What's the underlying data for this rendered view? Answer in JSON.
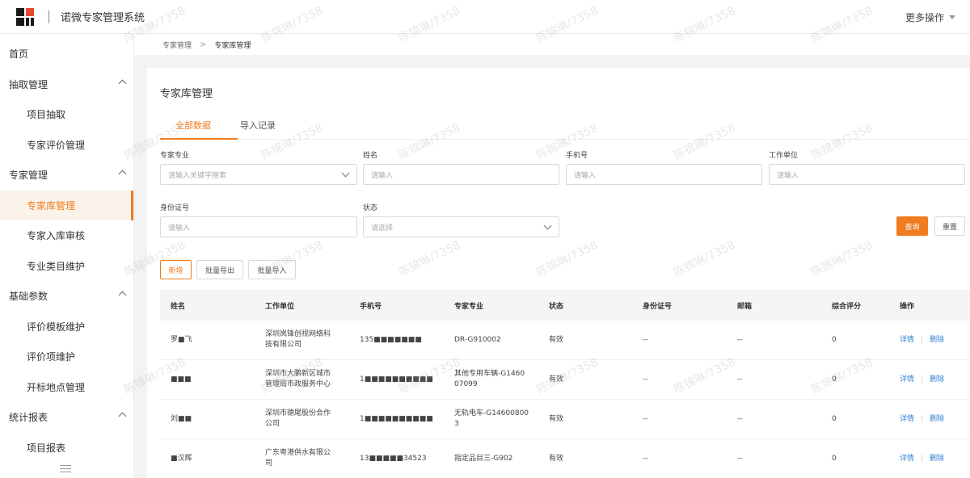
{
  "app": {
    "title": "诺微专家管理系统",
    "more_ops": "更多操作"
  },
  "sidebar": {
    "items": [
      {
        "label": "首页",
        "level": "top"
      },
      {
        "label": "抽取管理",
        "level": "top",
        "expanded": true
      },
      {
        "label": "项目抽取",
        "level": "sub"
      },
      {
        "label": "专家评价管理",
        "level": "sub"
      },
      {
        "label": "专家管理",
        "level": "top",
        "expanded": true
      },
      {
        "label": "专家库管理",
        "level": "sub",
        "active": true
      },
      {
        "label": "专家入库审核",
        "level": "sub"
      },
      {
        "label": "专业类目维护",
        "level": "sub"
      },
      {
        "label": "基础参数",
        "level": "top",
        "expanded": true
      },
      {
        "label": "评价模板维护",
        "level": "sub"
      },
      {
        "label": "评价项维护",
        "level": "sub"
      },
      {
        "label": "开标地点管理",
        "level": "sub"
      },
      {
        "label": "统计报表",
        "level": "top",
        "expanded": true
      },
      {
        "label": "项目报表",
        "level": "sub"
      }
    ]
  },
  "breadcrumb": {
    "items": [
      "专家管理",
      "专家库管理"
    ],
    "separator": ">"
  },
  "page": {
    "title": "专家库管理"
  },
  "tabs": [
    {
      "label": "全部数据",
      "active": true
    },
    {
      "label": "导入记录",
      "active": false
    }
  ],
  "filters": {
    "specialty": {
      "label": "专家专业",
      "placeholder": "请输入关键字搜索"
    },
    "name": {
      "label": "姓名",
      "placeholder": "请输入"
    },
    "phone": {
      "label": "手机号",
      "placeholder": "请输入"
    },
    "workplace": {
      "label": "工作单位",
      "placeholder": "请输入"
    },
    "id_number": {
      "label": "身份证号",
      "placeholder": "请输入"
    },
    "status": {
      "label": "状态",
      "placeholder": "请选择"
    }
  },
  "buttons": {
    "query": "查询",
    "reset": "重置",
    "add": "新增",
    "batch_export": "批量导出",
    "batch_import": "批量导入"
  },
  "table": {
    "headers": [
      "姓名",
      "工作单位",
      "手机号",
      "专家专业",
      "状态",
      "身份证号",
      "邮箱",
      "综合评分",
      "操作"
    ],
    "rows": [
      {
        "name": "罗■飞",
        "workplace": [
          "深圳岚锋创视网络科",
          "技有限公司"
        ],
        "phone": "135■■■■■■■",
        "specialty": [
          "DR-G910002"
        ],
        "status": "有效",
        "id_number": "--",
        "email": "--",
        "score": "0"
      },
      {
        "name": "■■■",
        "workplace": [
          "深圳市大鹏新区城市",
          "管理局市政服务中心"
        ],
        "phone": "1■■■■■■■■■■",
        "specialty": [
          "其他专用车辆-G1460",
          "07099"
        ],
        "status": "有效",
        "id_number": "--",
        "email": "--",
        "score": "0"
      },
      {
        "name": "刘■■",
        "workplace": [
          "深圳市德尾股份合作",
          "公司"
        ],
        "phone": "1■■■■■■■■■■",
        "specialty": [
          "无轨电车-G14600800",
          "3"
        ],
        "status": "有效",
        "id_number": "--",
        "email": "--",
        "score": "0"
      },
      {
        "name": "■汉辉",
        "workplace": [
          "广东粤港供水有限公",
          "司"
        ],
        "phone": "13■■■■■34523",
        "specialty": [
          "指定品目三-G902"
        ],
        "status": "有效",
        "id_number": "--",
        "email": "--",
        "score": "0"
      }
    ],
    "actions": {
      "detail": "详情",
      "delete": "删除"
    }
  },
  "watermark": "陈锦琳/7358",
  "colors": {
    "accent": "#f07c1f",
    "link": "#2f7fd6",
    "logo_red": "#e34a2f"
  },
  "icons": {
    "logo": "brand-logo-icon",
    "collapse": "menu-collapse-icon",
    "chevron": "chevron-up-icon",
    "dropdown": "chevron-down-icon"
  }
}
